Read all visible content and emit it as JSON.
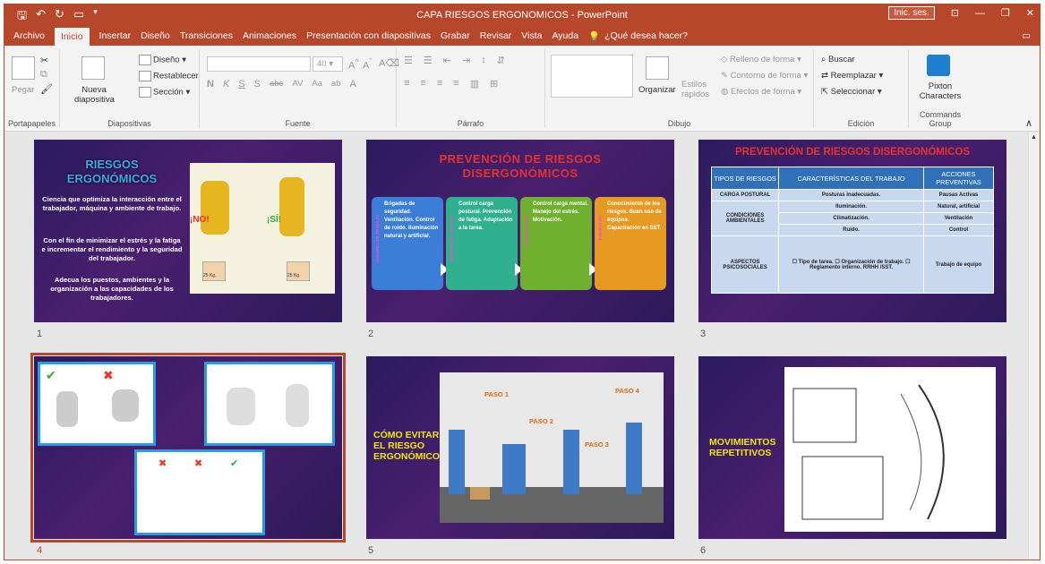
{
  "titlebar": {
    "title": "CAPA RIESGOS ERGONOMICOS  -  PowerPoint",
    "signin": "Inic. ses."
  },
  "tabs": [
    "Archivo",
    "Inicio",
    "Insertar",
    "Diseño",
    "Transiciones",
    "Animaciones",
    "Presentación con diapositivas",
    "Grabar",
    "Revisar",
    "Vista",
    "Ayuda"
  ],
  "tell_me": "¿Qué desea hacer?",
  "ribbon": {
    "portapapeles": {
      "label": "Portapapeles",
      "paste": "Pegar"
    },
    "diapositivas": {
      "label": "Diapositivas",
      "new_slide_1": "Nueva",
      "new_slide_2": "diapositiva",
      "layout": "Diseño",
      "reset": "Restablecer",
      "section": "Sección"
    },
    "fuente": {
      "label": "Fuente",
      "font_size": "40",
      "bold": "N",
      "italic": "K",
      "underline": "S",
      "shadow": "S",
      "strike": "abc",
      "spacing": "AV",
      "case": "Aa",
      "clear": "A"
    },
    "parrafo": {
      "label": "Párrafo"
    },
    "dibujo": {
      "label": "Dibujo",
      "arrange": "Organizar",
      "styles_1": "Estilos",
      "styles_2": "rápidos",
      "fill": "Relleno de forma",
      "outline": "Contorno de forma",
      "effects": "Efectos de forma"
    },
    "edicion": {
      "label": "Edición",
      "find": "Buscar",
      "replace": "Reemplazar",
      "select": "Seleccionar"
    },
    "commands": {
      "label": "Commands Group",
      "pixton_1": "Pixton",
      "pixton_2": "Characters"
    }
  },
  "slides": {
    "s1": {
      "num": "1",
      "title_1": "RIESGOS",
      "title_2": "ERGONÓMICOS",
      "p1": "Ciencia que optimiza la interacción entre el trabajador, máquina y ambiente de trabajo.",
      "p2": "Con el fin de minimizar el estrés y la fatiga e incrementar el rendimiento y la seguridad del trabajador.",
      "p3": "Adecua los puestos, ambientes y la organización a las capacidades de los trabajadores.",
      "no": "¡NO!",
      "si": "¡SÍ!",
      "kg": "25 Kg."
    },
    "s2": {
      "num": "2",
      "title_1": "PREVENCIÓN DE RIESGOS",
      "title_2": "DISERGONÓMICOS",
      "cards": [
        {
          "label": "LUGARES DE TRABAJO",
          "text": "Brigadas de seguridad. Ventilación. Control de ruido. Iluminación natural y artificial.",
          "color": "#3b7ed8"
        },
        {
          "label": "EQUIPOS DE TRABAJO",
          "text": "Control carga postural. Prevención de fatiga. Adaptación a la tarea.",
          "color": "#2fb08e"
        },
        {
          "label": "ORGANIZACIÓN",
          "text": "Control carga mental. Manejo del estrés. Motivación.",
          "color": "#6fb02e"
        },
        {
          "label": "FORMACIÓN",
          "text": "Conocimiento de los riesgos. Buen uso de equipos. Capacitación en SST.",
          "color": "#e69a22"
        }
      ]
    },
    "s3": {
      "num": "3",
      "title": "PREVENCIÓN DE RIESGOS DISERGONÓMICOS",
      "headers": [
        "TIPOS DE RIESGOS",
        "CARACTERÍSTICAS DEL TRABAJO",
        "ACCIONES PREVENTIVAS"
      ],
      "rows": [
        [
          "CARGA POSTURAL",
          "Posturas inadecuadas.",
          "Pausas Activas"
        ],
        [
          "CONDICIONES AMBIENTALES",
          "Iluminación.",
          "Natural, artificial"
        ],
        [
          "",
          "Climatización.",
          "Ventilación"
        ],
        [
          "",
          "Ruido.",
          "Control"
        ],
        [
          "ASPECTOS PSICOSOCIALES",
          "☐ Tipo de tarea. ☐ Organización de trabajo. ☐ Reglamento interno. RRHH /SST.",
          "Trabajo de equipo"
        ]
      ]
    },
    "s4": {
      "num": "4"
    },
    "s5": {
      "num": "5",
      "title_1": "CÓMO EVITAR",
      "title_2": "EL RIESGO",
      "title_3": "ERGONÓMICO",
      "paso1": "PASO 1",
      "paso2": "PASO 2",
      "paso3": "PASO 3",
      "paso4": "PASO 4"
    },
    "s6": {
      "num": "6",
      "title_1": "MOVIMIENTOS",
      "title_2": "REPETITIVOS"
    }
  },
  "colors": {
    "accent": "#b7472a",
    "slide_bg": "#2a1b5e",
    "title_blue": "#3aa9e6",
    "title_red": "#e8312d",
    "title_yellow": "#f4e500"
  }
}
